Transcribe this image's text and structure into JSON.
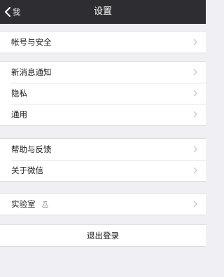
{
  "nav": {
    "back_label": "我",
    "title": "设置"
  },
  "groups": {
    "account": {
      "label": "帐号与安全"
    },
    "notify": {
      "label": "新消息通知"
    },
    "privacy": {
      "label": "隐私"
    },
    "general": {
      "label": "通用"
    },
    "help": {
      "label": "帮助与反馈"
    },
    "about": {
      "label": "关于微信"
    },
    "lab": {
      "label": "实验室",
      "icon": "lab-flask-icon"
    }
  },
  "logout": {
    "label": "退出登录"
  },
  "colors": {
    "navbar_bg": "#2e2e32",
    "page_bg": "#efeff4",
    "cell_bg": "#ffffff",
    "chevron": "#c7c7cc"
  }
}
